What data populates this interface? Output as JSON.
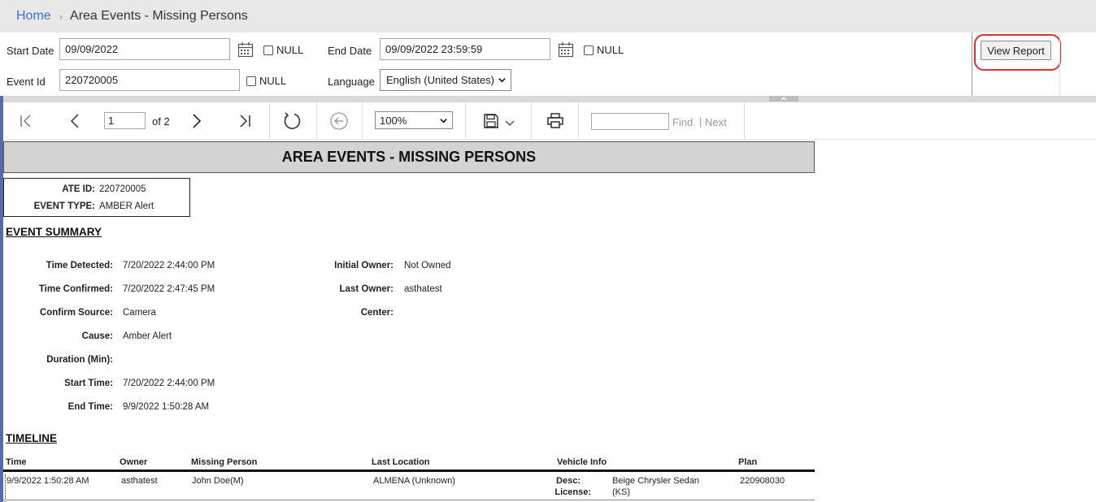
{
  "breadcrumb": {
    "home": "Home",
    "separator": "›",
    "current": "Area Events - Missing Persons"
  },
  "params": {
    "start_date": {
      "label": "Start Date",
      "value": "09/09/2022",
      "null_label": "NULL",
      "null_checked": false
    },
    "end_date": {
      "label": "End Date",
      "value": "09/09/2022 23:59:59",
      "null_label": "NULL",
      "null_checked": false
    },
    "event_id": {
      "label": "Event Id",
      "value": "220720005",
      "null_label": "NULL",
      "null_checked": false
    },
    "language": {
      "label": "Language",
      "value": "English (United States)"
    },
    "view_report": "View Report"
  },
  "toolbar": {
    "page_current": "1",
    "page_of": "of 2",
    "zoom": "100%",
    "find_value": "",
    "find_label": "Find",
    "find_separator": "|",
    "next_label": "Next",
    "icons": [
      "first-page-icon",
      "previous-page-icon",
      "next-page-icon",
      "last-page-icon",
      "refresh-icon",
      "back-icon",
      "save-icon",
      "print-icon"
    ]
  },
  "report": {
    "title": "AREA EVENTS - MISSING PERSONS",
    "ate_id": {
      "label": "ATE ID:",
      "value": "220720005"
    },
    "event_type": {
      "label": "EVENT TYPE:",
      "value": "AMBER Alert"
    },
    "event_summary_heading": "EVENT SUMMARY",
    "summary_left": [
      {
        "label": "Time Detected:",
        "value": "7/20/2022 2:44:00 PM"
      },
      {
        "label": "Time Confirmed:",
        "value": "7/20/2022 2:47:45 PM"
      },
      {
        "label": "Confirm Source:",
        "value": "Camera"
      },
      {
        "label": "Cause:",
        "value": "Amber Alert"
      },
      {
        "label": "Duration (Min):",
        "value": ""
      },
      {
        "label": "Start Time:",
        "value": "7/20/2022 2:44:00 PM"
      },
      {
        "label": "End Time:",
        "value": "9/9/2022 1:50:28 AM"
      }
    ],
    "summary_right": [
      {
        "label": "Initial Owner:",
        "value": "Not Owned"
      },
      {
        "label": "Last Owner:",
        "value": "asthatest"
      },
      {
        "label": "Center:",
        "value": ""
      }
    ],
    "timeline_heading": "TIMELINE",
    "timeline_columns": [
      "Time",
      "Owner",
      "Missing Person",
      "Last Location",
      "Vehicle Info",
      "Plan"
    ],
    "timeline_rows": [
      {
        "time": "9/9/2022 1:50:28 AM",
        "owner": "asthatest",
        "missing_person": "John Doe(M)",
        "last_location": "ALMENA (Unknown)",
        "vehicle_desc_label": "Desc:",
        "vehicle_license_label": "License:",
        "vehicle_desc": "Beige Chrysler Sedan",
        "vehicle_license": "(KS)",
        "plan": "220908030"
      }
    ]
  },
  "colors": {
    "link": "#3b6fd1",
    "highlight_oval": "#d93030",
    "title_bar": "#d3d3d3"
  }
}
